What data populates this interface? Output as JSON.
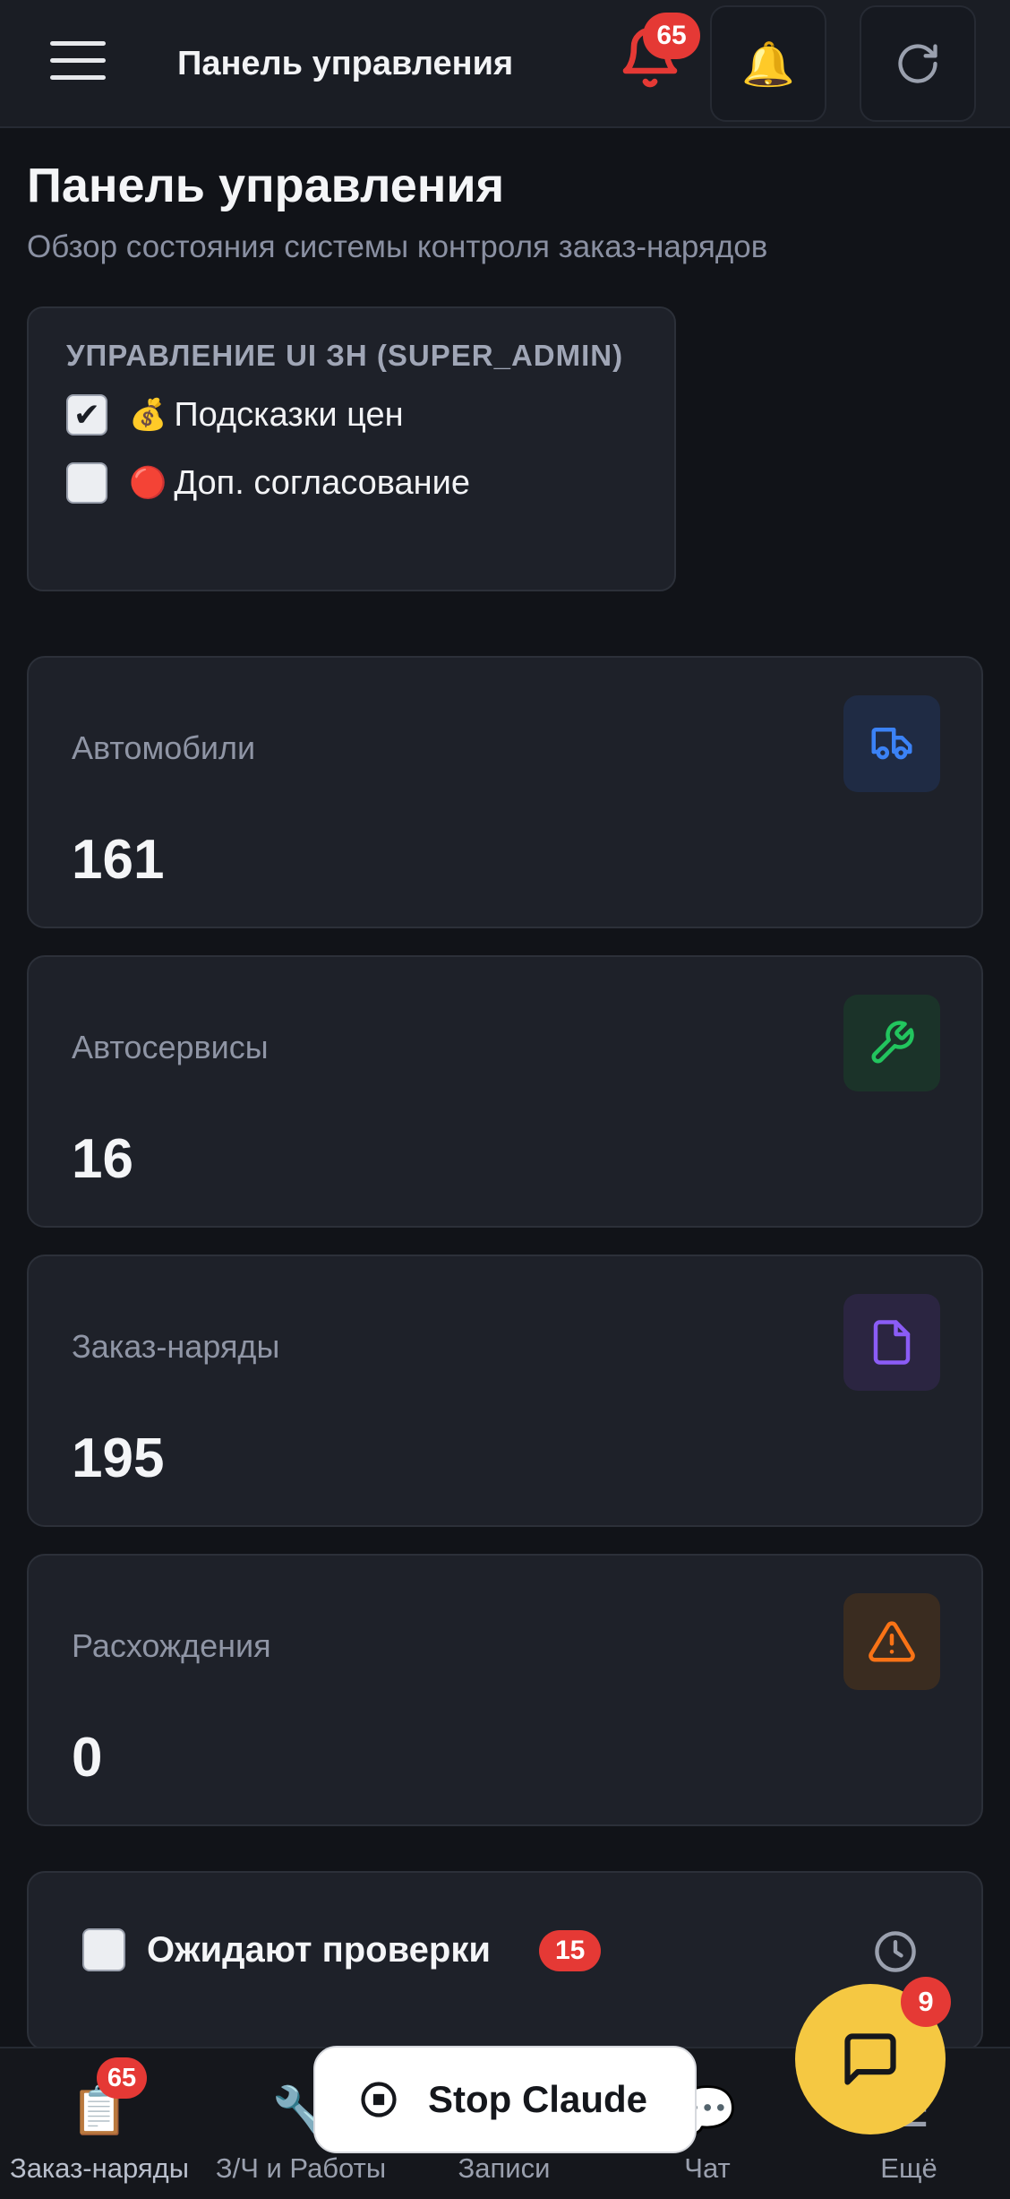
{
  "header": {
    "title": "Панель управления",
    "notification_count": "65"
  },
  "page": {
    "title": "Панель управления",
    "subtitle": "Обзор состояния системы контроля заказ-нарядов"
  },
  "admin_panel": {
    "heading": "УПРАВЛЕНИЕ UI ЗН (SUPER_ADMIN)",
    "options": [
      {
        "emoji": "💰",
        "label": "Подсказки цен",
        "checked": true
      },
      {
        "emoji": "🔴",
        "label": "Доп. согласование",
        "checked": false
      }
    ]
  },
  "stats": [
    {
      "label": "Автомобили",
      "value": "161",
      "icon": "truck-icon",
      "color": "#3b82f6"
    },
    {
      "label": "Автосервисы",
      "value": "16",
      "icon": "wrench-icon",
      "color": "#22c55e"
    },
    {
      "label": "Заказ-наряды",
      "value": "195",
      "icon": "document-icon",
      "color": "#8b5cf6"
    },
    {
      "label": "Расхождения",
      "value": "0",
      "icon": "warning-icon",
      "color": "#f97316"
    }
  ],
  "pending": {
    "title": "Ожидают проверки",
    "count": "15"
  },
  "bottom_nav": {
    "items": [
      {
        "icon": "📋",
        "label": "Заказ-наряды",
        "badge": "65"
      },
      {
        "icon": "🔧",
        "label": "З/Ч и Работы"
      },
      {
        "icon": "📅",
        "label": "Записи"
      },
      {
        "icon": "💬",
        "label": "Чат"
      },
      {
        "icon": "☰",
        "label": "Ещё"
      }
    ]
  },
  "stop_button": {
    "label": "Stop Claude"
  },
  "chat_fab": {
    "badge": "9"
  },
  "colors": {
    "accent_yellow": "#f5c842",
    "badge_red": "#e53935",
    "background": "#111318"
  }
}
